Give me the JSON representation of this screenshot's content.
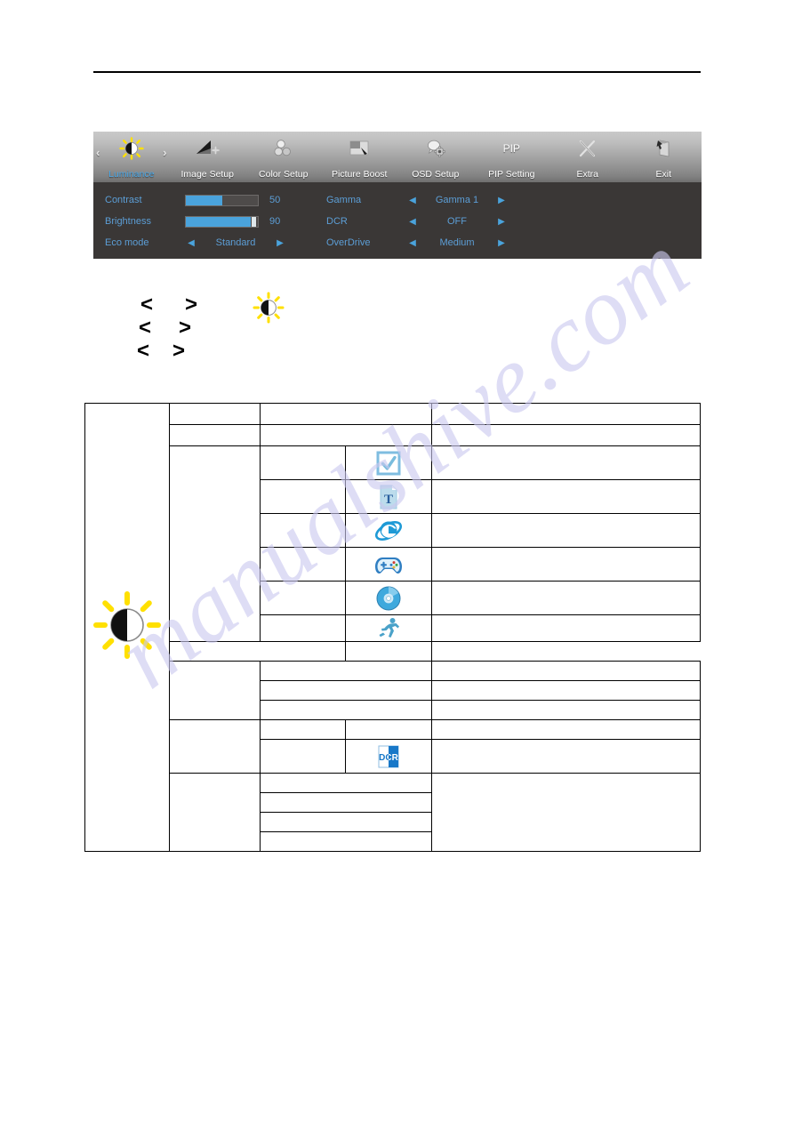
{
  "page": {
    "watermark_text": "manualshive.com",
    "has_top_rule": true
  },
  "osd": {
    "tabs": [
      {
        "label": "Luminance",
        "icon": "brightness-sun-icon",
        "active": true,
        "has_chevrons": true
      },
      {
        "label": "Image Setup",
        "icon": "image-setup-icon",
        "active": false,
        "has_chevrons": false
      },
      {
        "label": "Color Setup",
        "icon": "color-setup-icon",
        "active": false,
        "has_chevrons": false
      },
      {
        "label": "Picture Boost",
        "icon": "picture-boost-icon",
        "active": false,
        "has_chevrons": false
      },
      {
        "label": "OSD Setup",
        "icon": "osd-setup-icon",
        "active": false,
        "has_chevrons": false
      },
      {
        "label": "PIP Setting",
        "icon": "pip-text-icon",
        "active": false,
        "has_chevrons": false,
        "icon_text": "PIP"
      },
      {
        "label": "Extra",
        "icon": "extra-tools-icon",
        "active": false,
        "has_chevrons": false
      },
      {
        "label": "Exit",
        "icon": "exit-door-icon",
        "active": false,
        "has_chevrons": false
      }
    ],
    "left_column": [
      {
        "label": "Contrast",
        "type": "slider",
        "value": "50",
        "fill_pct": 50
      },
      {
        "label": "Brightness",
        "type": "slider",
        "value": "90",
        "fill_pct": 90
      },
      {
        "label": "Eco mode",
        "type": "option",
        "value": "Standard",
        "arrow_left": "◀",
        "arrow_right": "▶"
      }
    ],
    "right_column": [
      {
        "label": "Gamma",
        "type": "option",
        "value": "Gamma 1",
        "arrow_left": "◀",
        "arrow_right": "▶"
      },
      {
        "label": "DCR",
        "type": "option",
        "value": "OFF",
        "arrow_left": "◀",
        "arrow_right": "▶"
      },
      {
        "label": "OverDrive",
        "type": "option",
        "value": "Medium",
        "arrow_left": "◀",
        "arrow_right": "▶"
      }
    ]
  },
  "nav_arrows": {
    "rows": [
      {
        "left": "<",
        "right": ">"
      },
      {
        "left": "<",
        "right": ">"
      },
      {
        "left": "<",
        "right": ">"
      }
    ],
    "sun_icon": "brightness-sun-icon"
  },
  "spec_table": {
    "category_icon": "brightness-sun-icon",
    "rows": [
      {
        "c1": "",
        "c2": "",
        "c3": "",
        "c4": "",
        "icon": null
      },
      {
        "c1": "",
        "c2": "",
        "c3": "",
        "c4": "",
        "icon": null
      },
      {
        "c1": "",
        "c2": "",
        "c3": "",
        "c4": "",
        "icon": "checkbox-check-icon"
      },
      {
        "c1": "",
        "c2": "",
        "c3": "",
        "c4": "",
        "icon": "text-document-icon"
      },
      {
        "c1": "",
        "c2": "",
        "c3": "",
        "c4": "",
        "icon": "internet-explorer-icon"
      },
      {
        "c1": "",
        "c2": "",
        "c3": "",
        "c4": "",
        "icon": "game-controller-icon"
      },
      {
        "c1": "",
        "c2": "",
        "c3": "",
        "c4": "",
        "icon": "movie-disc-icon"
      },
      {
        "c1": "",
        "c2": "",
        "c3": "",
        "c4": "",
        "icon": "sports-runner-icon"
      },
      {
        "c1": "",
        "c2": "",
        "c3": "",
        "c4": "",
        "icon": null
      },
      {
        "c1": "",
        "c2": "",
        "c3": "",
        "c4": "",
        "icon": null
      },
      {
        "c1": "",
        "c2": "",
        "c3": "",
        "c4": "",
        "icon": null
      },
      {
        "c1": "",
        "c2": "",
        "c3": "",
        "c4": "",
        "icon": null
      },
      {
        "c1": "",
        "c2": "",
        "c3": "",
        "c4": "",
        "icon": null
      },
      {
        "c1": "",
        "c2": "",
        "c3": "",
        "c4": "",
        "icon": "dcr-badge-icon"
      },
      {
        "c1": "",
        "c2": "",
        "c3": "",
        "c4": "",
        "icon": null
      },
      {
        "c1": "",
        "c2": "",
        "c3": "",
        "c4": "",
        "icon": null
      },
      {
        "c1": "",
        "c2": "",
        "c3": "",
        "c4": "",
        "icon": null
      },
      {
        "c1": "",
        "c2": "",
        "c3": "",
        "c4": "",
        "icon": null
      }
    ]
  },
  "colors": {
    "osd_accent": "#4aa3dc",
    "osd_text": "#5c9ed6",
    "osd_body_bg": "#3a3736",
    "watermark": "#cbc9ef",
    "sun_yellow": "#ffe000"
  }
}
